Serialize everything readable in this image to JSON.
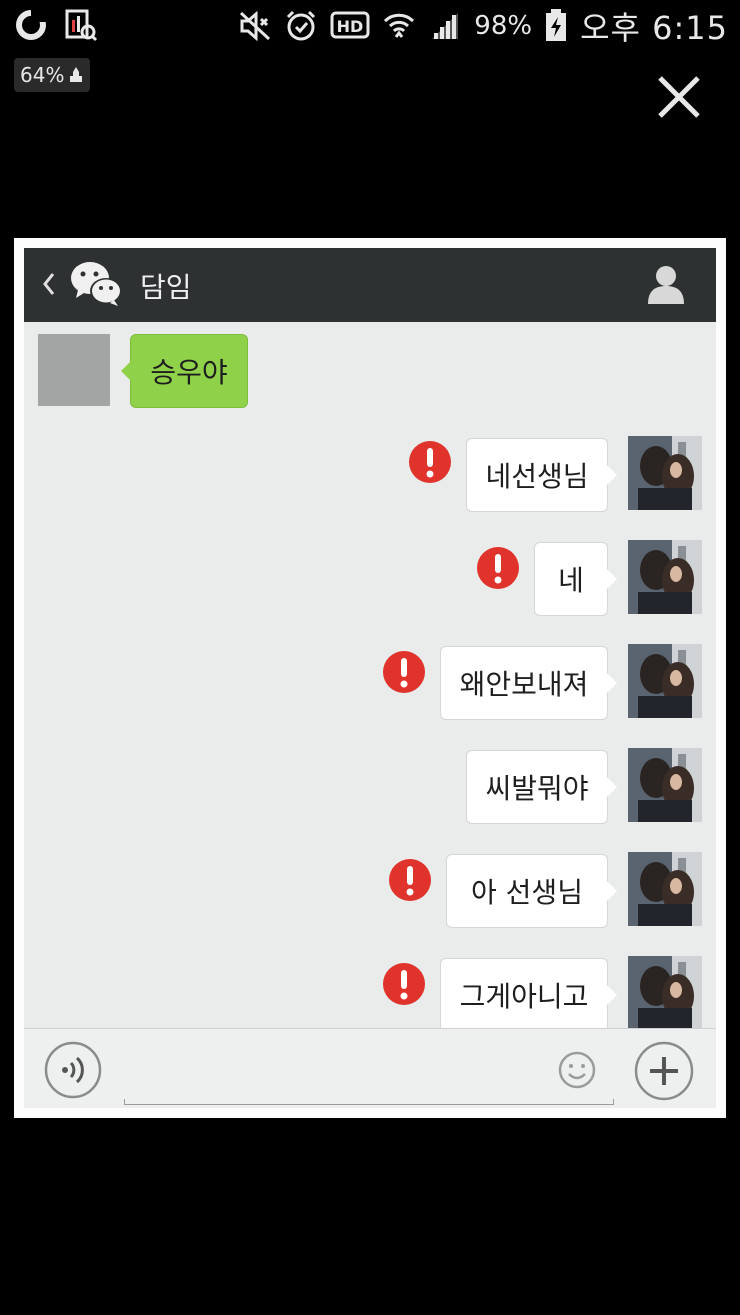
{
  "status_bar": {
    "battery_percent": "98%",
    "time": "오후 6:15",
    "battery_badge": "64%"
  },
  "chat": {
    "title": "담임",
    "messages": [
      {
        "direction": "incoming",
        "text": "승우야",
        "failed": false
      },
      {
        "direction": "outgoing",
        "text": "네선생님",
        "failed": true
      },
      {
        "direction": "outgoing",
        "text": "네",
        "failed": true
      },
      {
        "direction": "outgoing",
        "text": "왜안보내져",
        "failed": true
      },
      {
        "direction": "outgoing",
        "text": "씨발뭐야",
        "failed": false
      },
      {
        "direction": "outgoing",
        "text": "아 선생님",
        "failed": true
      },
      {
        "direction": "outgoing",
        "text": "그게아니고",
        "failed": true
      }
    ]
  },
  "input_bar": {
    "value": "",
    "placeholder": ""
  },
  "colors": {
    "header": "#2e3132",
    "incoming_bubble": "#8fd24a",
    "outgoing_bubble": "#ffffff",
    "chat_background": "#e9eceb",
    "error_red": "#e0332b"
  },
  "icons": [
    "back-chevron-icon",
    "wechat-logo-icon",
    "profile-icon",
    "error-icon",
    "voice-icon",
    "emoji-icon",
    "plus-icon",
    "close-icon"
  ]
}
